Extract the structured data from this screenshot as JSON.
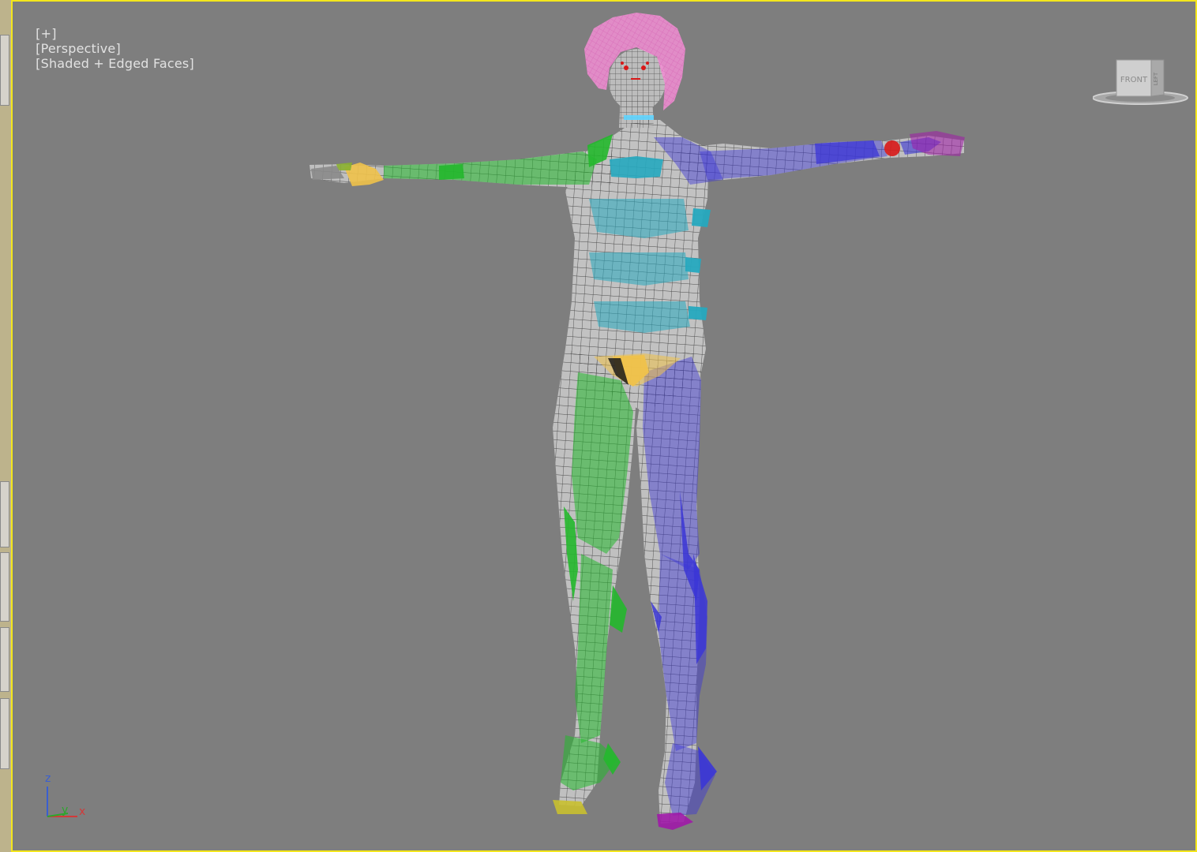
{
  "viewport": {
    "label_plus": "[+]",
    "label_view": "[Perspective]",
    "label_shading": "[Shaded + Edged Faces]"
  },
  "viewcube": {
    "face_label": "FRONT",
    "side_label": "LEFT"
  },
  "axis": {
    "z": "z",
    "y": "y",
    "x": "x"
  },
  "colors": {
    "viewport_bg": "#7e7e7e",
    "active_border": "#f4e61c",
    "mesh_base": "#c8c8c8",
    "wire": "#4a4a4a",
    "hair": "#f28ed4",
    "green": "#23b82c",
    "blue": "#3b36d6",
    "cyan": "#26a9bf",
    "yellow": "#f0c24a",
    "red": "#d81818",
    "magenta": "#a01aa8"
  },
  "icons": [
    "viewcube-icon",
    "axis-tripod-icon"
  ]
}
